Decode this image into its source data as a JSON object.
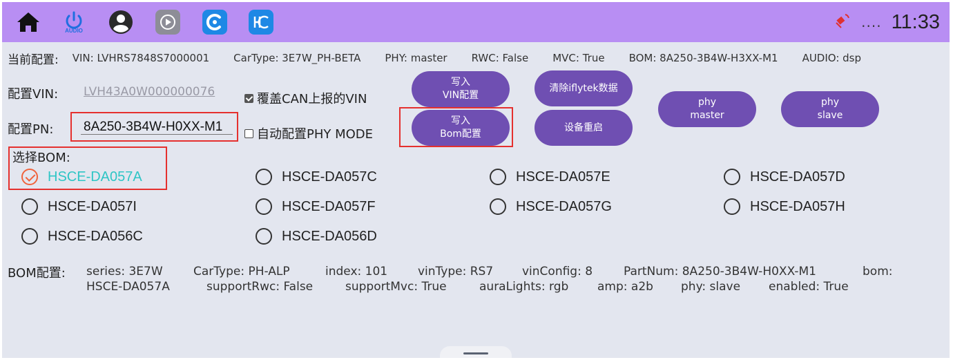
{
  "statusbar": {
    "audio_label": "AUDIO",
    "dots": "....",
    "time": "11:33"
  },
  "info": {
    "label": "当前配置:",
    "vin": "VIN: LVHRS7848S7000001",
    "cartype": "CarType: 3E7W_PH-BETA",
    "phy": "PHY: master",
    "rwc": "RWC: False",
    "mvc": "MVC: True",
    "bom": "BOM: 8A250-3B4W-H3XX-M1",
    "audio": "AUDIO: dsp"
  },
  "config": {
    "vin_label": "配置VIN:",
    "vin_value": "LVH43A0W000000076",
    "override_label": "覆盖CAN上报的VIN",
    "override_checked": true,
    "pn_label": "配置PN:",
    "pn_value": "8A250-3B4W-H0XX-M1",
    "auto_phy_label": "自动配置PHY MODE",
    "auto_phy_checked": false
  },
  "buttons": {
    "write_vin_line1": "写入",
    "write_vin_line2": "VIN配置",
    "clear_iflytek": "清除iflytek数据",
    "phy_master_line1": "phy",
    "phy_master_line2": "master",
    "phy_slave_line1": "phy",
    "phy_slave_line2": "slave",
    "write_bom_line1": "写入",
    "write_bom_line2": "Bom配置",
    "reboot": "设备重启"
  },
  "bom_select": {
    "label": "选择BOM:",
    "options": [
      {
        "name": "HSCE-DA057A",
        "selected": true
      },
      {
        "name": "HSCE-DA057C",
        "selected": false
      },
      {
        "name": "HSCE-DA057E",
        "selected": false
      },
      {
        "name": "HSCE-DA057D",
        "selected": false
      },
      {
        "name": "HSCE-DA057I",
        "selected": false
      },
      {
        "name": "HSCE-DA057F",
        "selected": false
      },
      {
        "name": "HSCE-DA057G",
        "selected": false
      },
      {
        "name": "HSCE-DA057H",
        "selected": false
      },
      {
        "name": "HSCE-DA056C",
        "selected": false
      },
      {
        "name": "HSCE-DA056D",
        "selected": false
      }
    ]
  },
  "bom_config": {
    "label": "BOM配置:",
    "line1": [
      "series: 3E7W",
      "CarType: PH-ALP",
      "index: 101",
      "vinType: RS7",
      "vinConfig: 8",
      "PartNum: 8A250-3B4W-H0XX-M1",
      "bom:"
    ],
    "line2": [
      "HSCE-DA057A",
      "supportRwc: False",
      "supportMvc: True",
      "auraLights: rgb",
      "amp: a2b",
      "phy: slave",
      "enabled: True"
    ]
  },
  "colors": {
    "topbar": "#b88ef3",
    "button": "#6f4fb2",
    "highlight_frame": "#e5302e",
    "selected_text": "#2ec5c5",
    "selected_check": "#f0633c"
  }
}
